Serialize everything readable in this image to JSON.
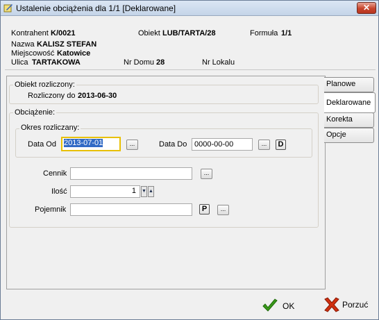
{
  "window": {
    "title": "Ustalenie obciążenia dla 1/1   [Deklarowane]",
    "close_glyph": "✕"
  },
  "header": {
    "kontrahent_label": "Kontrahent",
    "kontrahent_value": "K/0021",
    "obiekt_label": "Obiekt",
    "obiekt_value": "LUB/TARTA/28",
    "formula_label": "Formuła",
    "formula_value": "1/1",
    "nazwa_label": "Nazwa",
    "nazwa_value": "KALISZ STEFAN",
    "miejscowosc_label": "Miejscowość",
    "miejscowosc_value": "Katowice",
    "ulica_label": "Ulica",
    "ulica_value": "TARTAKOWA",
    "nr_domu_label": "Nr Domu",
    "nr_domu_value": "28",
    "nr_lokalu_label": "Nr Lokalu",
    "nr_lokalu_value": ""
  },
  "obiekt_rozliczony": {
    "group_title": "Obiekt rozliczony:",
    "rozliczony_do_label": "Rozliczony do",
    "rozliczony_do_value": "2013-06-30"
  },
  "obciazenie": {
    "group_title": "Obciążenie:",
    "okres": {
      "group_title": "Okres rozliczany:",
      "data_od_label": "Data Od",
      "data_od_value": "2013-07-01",
      "data_do_label": "Data Do",
      "data_do_value": "0000-00-00",
      "ellipsis": "...",
      "d_button": "D"
    },
    "cennik_label": "Cennik",
    "cennik_value": "",
    "ilosc_label": "Ilość",
    "ilosc_value": "1",
    "pojemnik_label": "Pojemnik",
    "pojemnik_value": "",
    "p_button": "P",
    "ellipsis": "..."
  },
  "tabs": [
    {
      "label": "Planowe"
    },
    {
      "label": "Deklarowane"
    },
    {
      "label": "Korekta"
    },
    {
      "label": "Opcje"
    }
  ],
  "footer": {
    "ok_label": "OK",
    "cancel_label": "Porzuć"
  },
  "colors": {
    "selection": "#316ac5",
    "focus_border": "#e8c000",
    "ok_check": "#3a9a1a",
    "cancel_x": "#d03010"
  }
}
